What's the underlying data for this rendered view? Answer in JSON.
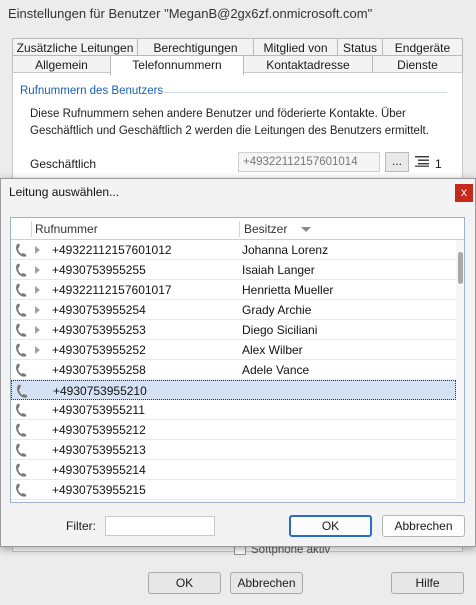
{
  "background_window": {
    "title": "Einstellungen für Benutzer \"MeganB@2gx6zf.onmicrosoft.com\"",
    "tabs_row1": [
      "Zusätzliche Leitungen",
      "Berechtigungen",
      "Mitglied von",
      "Status",
      "Endgeräte"
    ],
    "tabs_row2": [
      "Allgemein",
      "Telefonnummern",
      "Kontaktadresse",
      "Dienste"
    ],
    "active_tab": "Telefonnummern",
    "section_title": "Rufnummern des Benutzers",
    "description": "Diese Rufnummern sehen andere Benutzer und föderierte Kontakte. Über Geschäftlich und Geschäftlich 2 werden die Leitungen des Benutzers ermittelt.",
    "business_label": "Geschäftlich",
    "business_number": "+49322112157601014",
    "dots_label": "...",
    "lines_count": "1",
    "softphone_label": "Softphone aktiv",
    "ok_label": "OK",
    "cancel_label": "Abbrechen",
    "help_label": "Hilfe"
  },
  "dialog": {
    "title": "Leitung auswählen...",
    "close_label": "x",
    "columns": {
      "number": "Rufnummer",
      "owner": "Besitzer"
    },
    "rows": [
      {
        "number": "+49322112157601012",
        "owner": "Johanna Lorenz",
        "expandable": true
      },
      {
        "number": "+4930753955255",
        "owner": "Isaiah Langer",
        "expandable": true
      },
      {
        "number": "+49322112157601017",
        "owner": "Henrietta Mueller",
        "expandable": true
      },
      {
        "number": "+4930753955254",
        "owner": "Grady Archie",
        "expandable": true
      },
      {
        "number": "+4930753955253",
        "owner": "Diego Siciliani",
        "expandable": true
      },
      {
        "number": "+4930753955252",
        "owner": "Alex Wilber",
        "expandable": true
      },
      {
        "number": "+4930753955258",
        "owner": "Adele Vance",
        "expandable": false
      },
      {
        "number": "+4930753955210",
        "owner": "",
        "expandable": false,
        "selected": true
      },
      {
        "number": "+4930753955211",
        "owner": "",
        "expandable": false
      },
      {
        "number": "+4930753955212",
        "owner": "",
        "expandable": false
      },
      {
        "number": "+4930753955213",
        "owner": "",
        "expandable": false
      },
      {
        "number": "+4930753955214",
        "owner": "",
        "expandable": false
      },
      {
        "number": "+4930753955215",
        "owner": "",
        "expandable": false
      }
    ],
    "filter_label": "Filter:",
    "filter_value": "",
    "ok_label": "OK",
    "cancel_label": "Abbrechen",
    "accent_color": "#2a6cc9",
    "close_color": "#c42b1c"
  }
}
